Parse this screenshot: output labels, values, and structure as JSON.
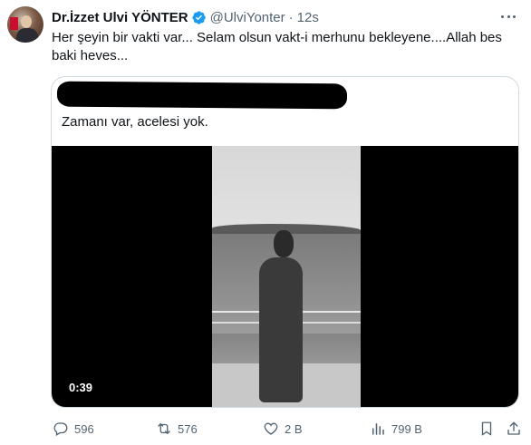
{
  "author": {
    "name": "Dr.İzzet Ulvi YÖNTER",
    "handle": "@UlviYonter",
    "separator": "·",
    "time": "12s",
    "verified": true
  },
  "tweet_text": "Her şeyin bir vakti var... Selam olsun vakt-i merhunu bekleyene....Allah bes baki heves...",
  "quoted": {
    "text": "Zamanı var, acelesi yok.",
    "video_duration": "0:39"
  },
  "actions": {
    "replies": "596",
    "retweets": "576",
    "likes": "2 B",
    "views": "799 B"
  },
  "icons": [
    "verified-badge-icon",
    "more-icon",
    "reply-icon",
    "retweet-icon",
    "like-icon",
    "views-icon",
    "bookmark-icon",
    "share-icon"
  ],
  "colors": {
    "text": "#0f1419",
    "secondary": "#536471",
    "verified": "#1d9bf0",
    "border": "#cfd9de"
  }
}
